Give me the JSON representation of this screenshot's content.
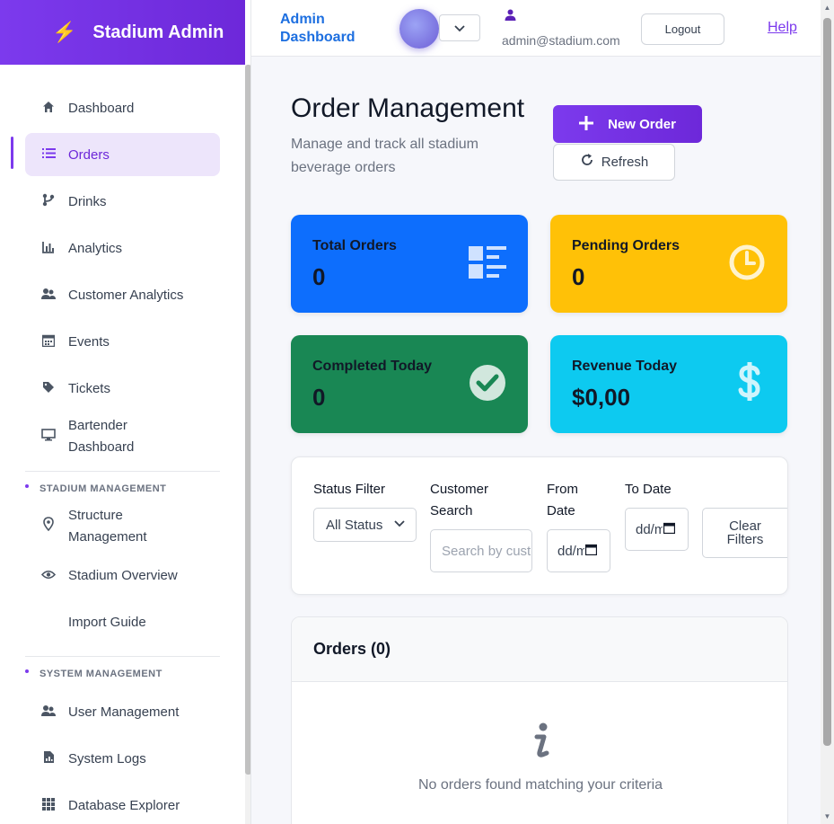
{
  "sidebar": {
    "brand": "Stadium Admin",
    "items": [
      {
        "label": "Dashboard",
        "icon": "home-icon"
      },
      {
        "label": "Orders",
        "icon": "list-icon",
        "active": true
      },
      {
        "label": "Drinks",
        "icon": "branch-icon"
      },
      {
        "label": "Analytics",
        "icon": "bar-chart-icon"
      },
      {
        "label": "Customer Analytics",
        "icon": "users-icon"
      },
      {
        "label": "Events",
        "icon": "calendar-icon"
      },
      {
        "label": "Tickets",
        "icon": "tag-icon"
      },
      {
        "label": "Bartender Dashboard",
        "icon": "monitor-icon"
      }
    ],
    "stadium_section": {
      "title": "STADIUM MANAGEMENT",
      "items": [
        {
          "label": "Structure Management",
          "icon": "map-pin-icon"
        },
        {
          "label": "Stadium Overview",
          "icon": "eye-icon"
        },
        {
          "label": "Import Guide",
          "icon": ""
        }
      ]
    },
    "system_section": {
      "title": "SYSTEM MANAGEMENT",
      "items": [
        {
          "label": "User Management",
          "icon": "users-icon"
        },
        {
          "label": "System Logs",
          "icon": "file-chart-icon"
        },
        {
          "label": "Database Explorer",
          "icon": "grid-icon"
        }
      ]
    }
  },
  "topbar": {
    "title": "Admin Dashboard",
    "user_email": "admin@stadium.com",
    "logout_label": "Logout",
    "help_label": "Help"
  },
  "page": {
    "title": "Order Management",
    "subtitle": "Manage and track all stadium beverage orders",
    "new_order_label": "New Order",
    "refresh_label": "Refresh"
  },
  "stats": {
    "total_orders": {
      "label": "Total Orders",
      "value": "0",
      "color": "#0d6efd"
    },
    "pending_orders": {
      "label": "Pending Orders",
      "value": "0",
      "color": "#ffc107"
    },
    "completed_today": {
      "label": "Completed Today",
      "value": "0",
      "color": "#198754"
    },
    "revenue_today": {
      "label": "Revenue Today",
      "value": "$0,00",
      "color": "#0dcaf0"
    }
  },
  "filters": {
    "status_label": "Status Filter",
    "status_value": "All Status",
    "customer_label": "Customer Search",
    "customer_placeholder": "Search by customer",
    "from_label": "From Date",
    "from_value": "dd/mm/yyyy",
    "to_label": "To Date",
    "to_value": "dd/mm/yyyy",
    "clear_label": "Clear Filters"
  },
  "orders": {
    "title": "Orders (0)",
    "empty_text": "No orders found matching your criteria"
  },
  "colors": {
    "accent": "#7c3aed",
    "link_blue": "#1d6fe0"
  }
}
